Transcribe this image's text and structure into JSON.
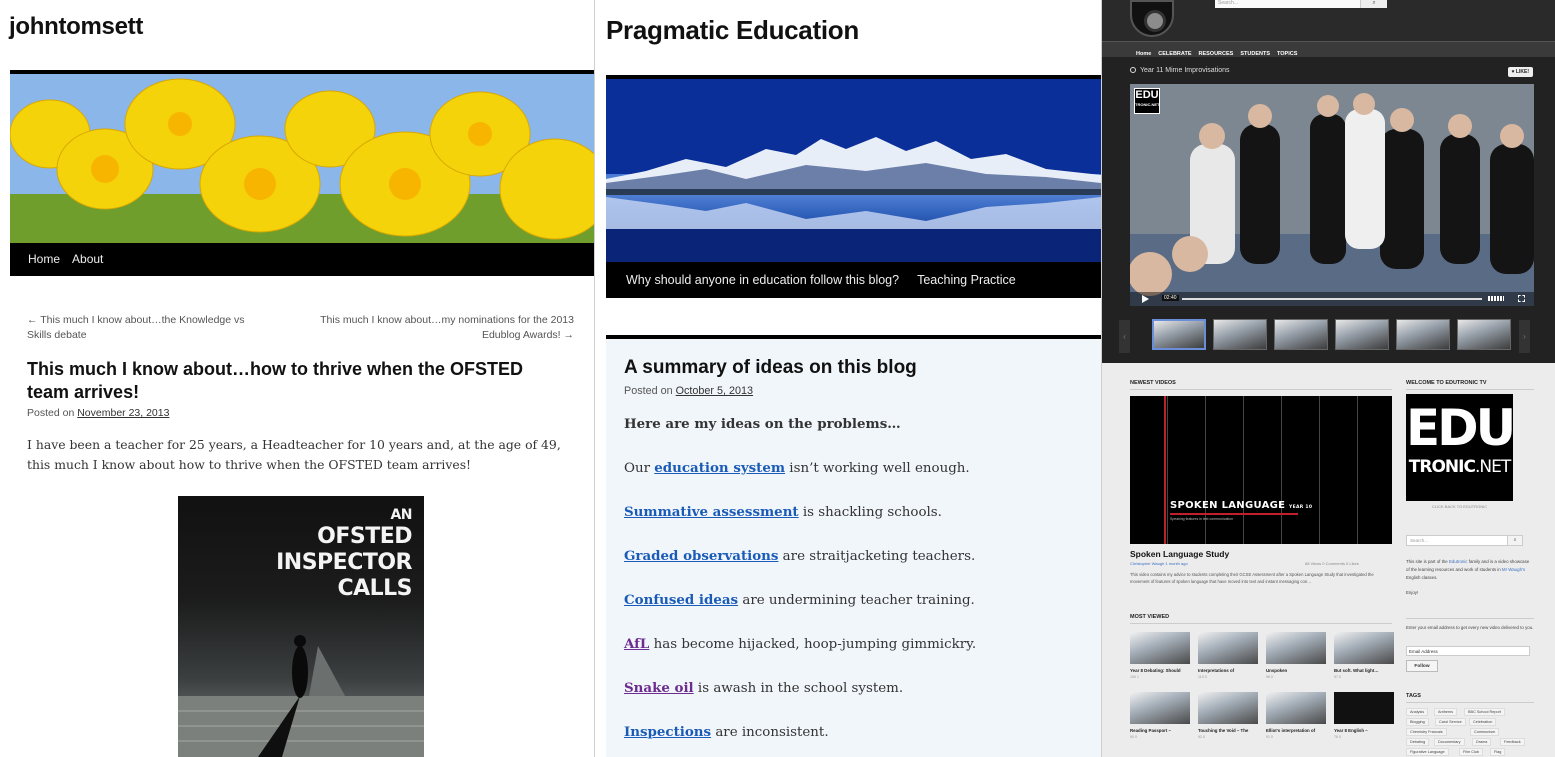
{
  "john": {
    "site_title": "johntomsett",
    "nav": [
      "Home",
      "About"
    ],
    "prev_post": "← This much I know about…the Knowledge vs Skills debate",
    "next_post": "This much I know about…my nominations for the 2013 Edublog Awards! →",
    "post_title": "This much I know about…how to thrive when the OFSTED team arrives!",
    "posted_on_label": "Posted on",
    "post_date": "November 23, 2013",
    "post_body": "I have been a teacher for 25 years, a Headteacher for 10 years and, at the age of 49, this much I know about how to thrive when the OFSTED team arrives!",
    "book": {
      "line1": "AN",
      "line2": "OFSTED INSPECTOR",
      "line3": "CALLS"
    }
  },
  "prag": {
    "site_title": "Pragmatic Education",
    "nav": [
      "Why should anyone in education follow this blog?",
      "Teaching Practice"
    ],
    "post_title": "A summary of ideas on this blog",
    "posted_on_label": "Posted on",
    "post_date": "October 5, 2013",
    "intro": "Here are my ideas on the problems…",
    "lines": [
      {
        "prefix": "Our ",
        "link": "education system",
        "rest": " isn’t working well enough.",
        "visited": false
      },
      {
        "prefix": "",
        "link": "Summative assessment",
        "rest": " is shackling schools.",
        "visited": false
      },
      {
        "prefix": "",
        "link": "Graded observations",
        "rest": " are straitjacketing teachers.",
        "visited": false
      },
      {
        "prefix": "",
        "link": "Confused ideas",
        "rest": " are undermining teacher training.",
        "visited": false
      },
      {
        "prefix": "",
        "link": "AfL",
        "rest": " has become hijacked, hoop-jumping gimmickry.",
        "visited": true
      },
      {
        "prefix": "",
        "link": "Snake oil",
        "rest": " is awash in the school system.",
        "visited": true
      },
      {
        "prefix": "",
        "link": "Inspections",
        "rest": " are inconsistent.",
        "visited": false
      }
    ],
    "colors": {
      "link": "#1b5bb8",
      "visited": "#6c2d8f"
    }
  },
  "edu": {
    "search_placeholder": "Search...",
    "menu": [
      "Home",
      "CELEBRATE",
      "RESOURCES",
      "STUDENTS",
      "TOPICS"
    ],
    "video_title": "Year 11 Mime Improvisations",
    "like_label": "♥ LIKE!",
    "badge": {
      "line1": "EDU",
      "line2": "TRONIC.NET"
    },
    "time": "02:40",
    "newest_heading": "NEWEST VIDEOS",
    "newest": {
      "label": "SPOKEN LANGUAGE",
      "label_small": "YEAR 10",
      "label_sub": "Speaking features in text communication",
      "title": "Spoken Language Study",
      "author": "Christopher Waugh 1 month ago",
      "stats": "68 Views   0 Comments   0 Likes",
      "desc": "This video contains my advice to students completing their GCSE Assessment after a Spoken Language Study that investigated the movement of features of spoken language that have moved into text and instant messaging con…"
    },
    "most_viewed_heading": "MOST VIEWED",
    "most_viewed": [
      {
        "title": "Year 8 Debating: Should",
        "stats": "100   1"
      },
      {
        "title": "Interpretations of",
        "stats": "119   0"
      },
      {
        "title": "Unspoken",
        "stats": "96   0"
      },
      {
        "title": "But soft. What light…",
        "stats": "97   0"
      },
      {
        "title": "Reading Passport –",
        "stats": "90   0"
      },
      {
        "title": "Touching the Void – The",
        "stats": "92   0"
      },
      {
        "title": "Elliot's interpretation of",
        "stats": "91   0"
      },
      {
        "title": "Year 8 English –",
        "stats": "76   0"
      }
    ],
    "welcome_heading": "WELCOME TO EDUTRONIC TV",
    "logo": {
      "line1": "EDU",
      "line2a": "TRONIC",
      "line2b": ".NET"
    },
    "click_back": "CLICK BACK TO EDUTRONIC",
    "side_search_placeholder": "Search...",
    "about_pre": "This site is part of the ",
    "about_link1": "Edutronic",
    "about_mid": " family and is a video showcase of the learning resources and work of students in ",
    "about_link2": "Mr Waugh's",
    "about_post": " English classes.",
    "enjoy": "Enjoy!",
    "email_prompt": "Enter your email address to get every new video delivered to you.",
    "email_placeholder": "Email Address",
    "follow_label": "Follow",
    "tags_heading": "TAGS",
    "tags": [
      "Analysis",
      "Anthems",
      "BBC School Report",
      "Blogging",
      "Carol Service",
      "Celebration",
      "Chemistry Francais",
      "Communism",
      "Debating",
      "Documentary",
      "Drama",
      "Feedback",
      "Figurative Language",
      "Film Club",
      "Flag"
    ]
  }
}
